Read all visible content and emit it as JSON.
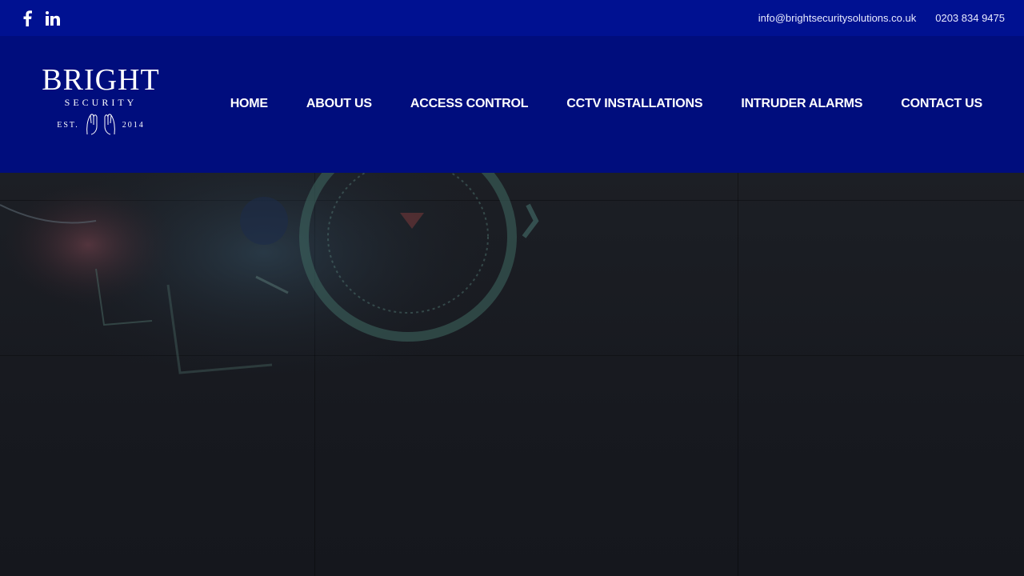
{
  "topbar": {
    "social": [
      {
        "icon": "facebook-icon"
      },
      {
        "icon": "linkedin-icon"
      }
    ],
    "email": "info@brightsecuritysolutions.co.uk",
    "phone": "0203 834 9475"
  },
  "logo": {
    "title": "BRIGHT",
    "subtitle": "SECURITY",
    "est_left": "EST.",
    "est_right": "2014"
  },
  "nav": {
    "items": [
      {
        "label": "HOME"
      },
      {
        "label": "ABOUT US"
      },
      {
        "label": "ACCESS CONTROL"
      },
      {
        "label": "CCTV INSTALLATIONS"
      },
      {
        "label": "INTRUDER ALARMS"
      },
      {
        "label": "CONTACT US"
      }
    ]
  },
  "colors": {
    "topbar": "#001191",
    "header": "#000d7d",
    "hero": "#17191f"
  }
}
